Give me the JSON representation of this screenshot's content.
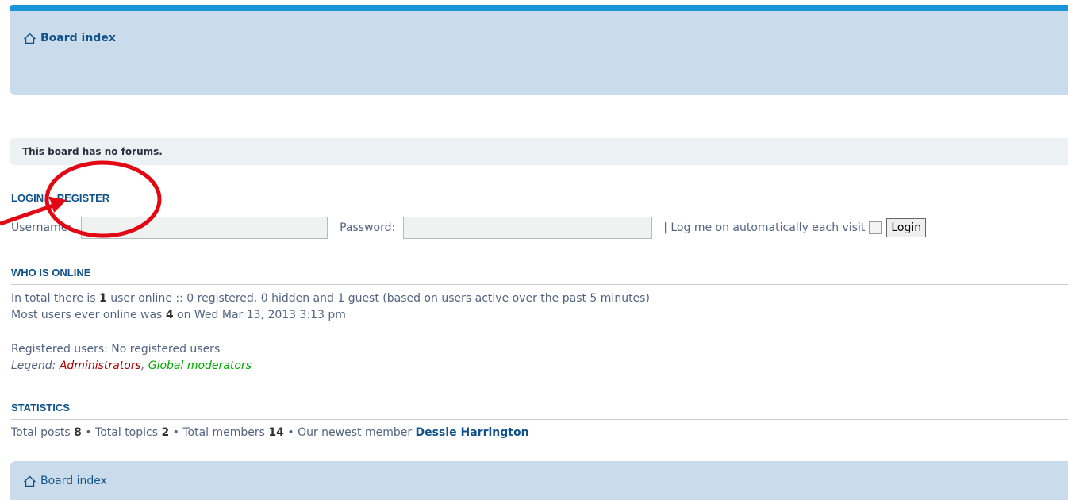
{
  "nav": {
    "breadcrumb": "Board index",
    "home_icon": "home-icon"
  },
  "notice": "This board has no forums.",
  "login": {
    "login_link": "LOGIN",
    "separator": "•",
    "register_link": "REGISTER",
    "username_label": "Username:",
    "username_value": "",
    "password_label": "Password:",
    "password_value": "",
    "auto_label": "| Log me on automatically each visit",
    "auto_checked": false,
    "login_button": "Login"
  },
  "who_online": {
    "heading": "WHO IS ONLINE",
    "line1_pre": "In total there is ",
    "line1_count": "1",
    "line1_post": " user online :: 0 registered, 0 hidden and 1 guest (based on users active over the past 5 minutes)",
    "line2_pre": "Most users ever online was ",
    "line2_count": "4",
    "line2_post": " on Wed Mar 13, 2013 3:13 pm",
    "registered": "Registered users: No registered users",
    "legend_label": "Legend: ",
    "legend_admin": "Administrators",
    "legend_comma": ", ",
    "legend_gmod": "Global moderators"
  },
  "statistics": {
    "heading": "STATISTICS",
    "posts_label": "Total posts ",
    "posts": "8",
    "topics_label": " • Total topics ",
    "topics": "2",
    "members_label": " • Total members ",
    "members": "14",
    "newest_label": " • Our newest member ",
    "newest": "Dessie Harrington"
  },
  "footer": {
    "breadcrumb": "Board index",
    "home_icon": "home-icon"
  },
  "colors": {
    "accent": "#105289",
    "nav_bg": "#cadceb",
    "annotation": "#e30613"
  }
}
